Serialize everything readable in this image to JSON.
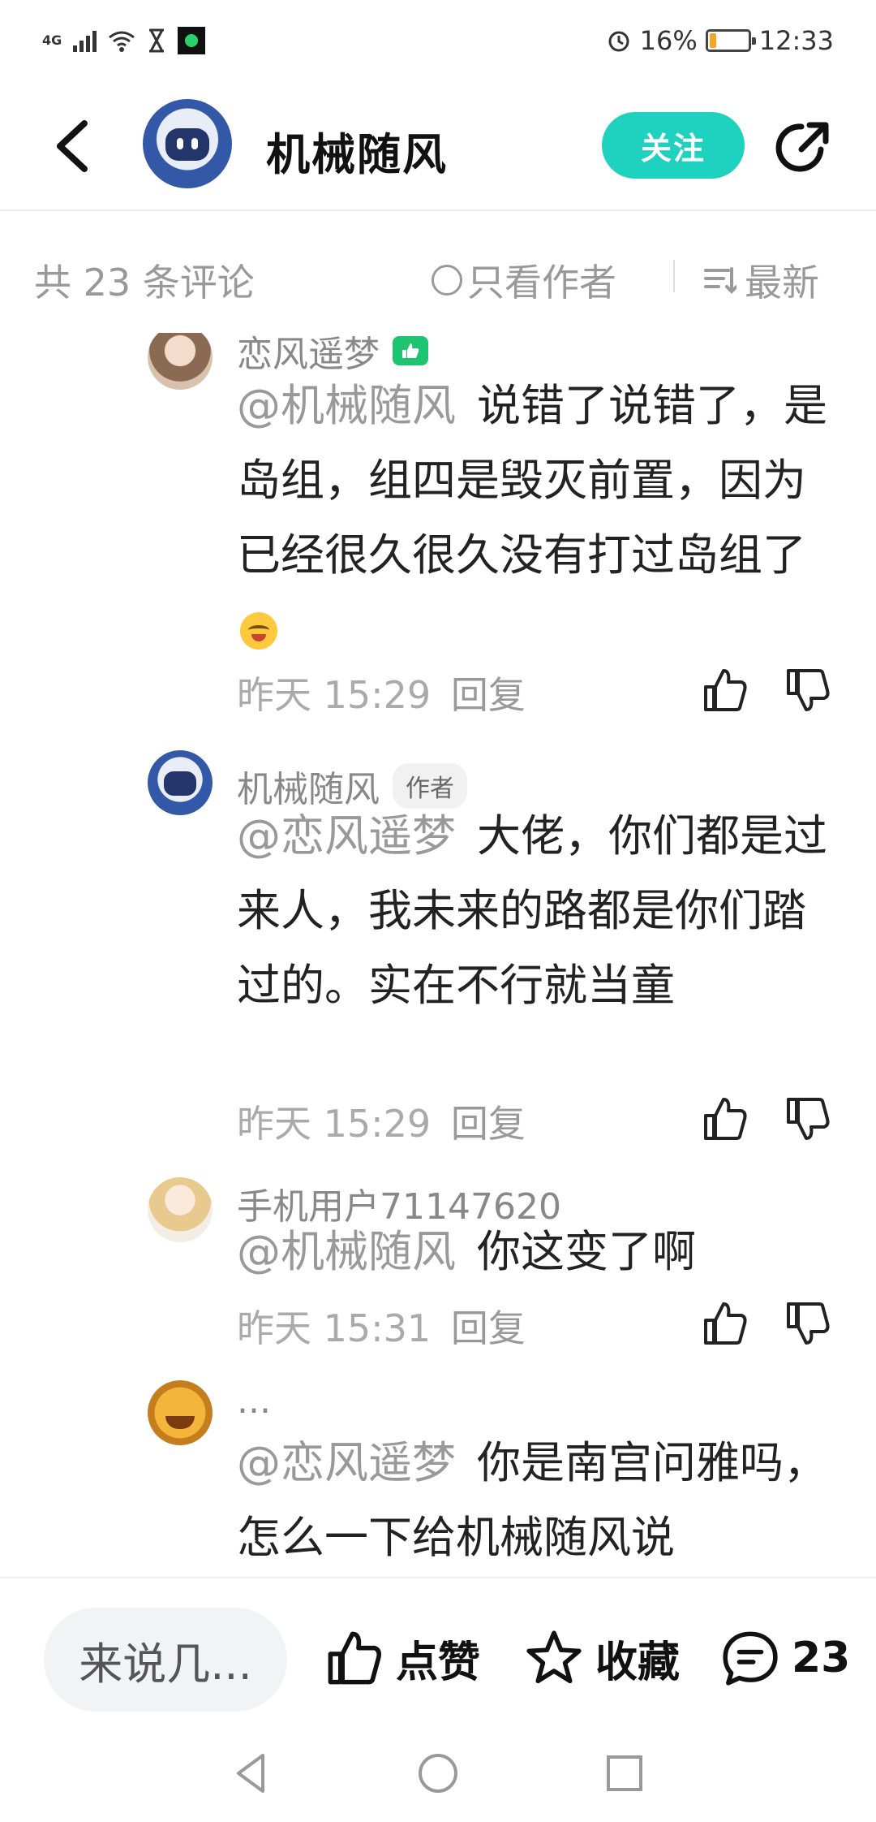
{
  "status_bar": {
    "network": "4G",
    "battery_percent": "16%",
    "time": "12:33",
    "icons": [
      "signal-icon",
      "wifi-icon",
      "hourglass-icon",
      "app-badge-icon",
      "alarm-icon",
      "battery-icon"
    ],
    "battery_level": 0.16
  },
  "header": {
    "title": "机械随风",
    "follow_label": "关注",
    "accent_color": "#1fd1bf"
  },
  "filter_bar": {
    "count_label": "共 23 条评论",
    "author_only_label": "只看作者",
    "sort_label": "最新"
  },
  "comments": [
    {
      "name": "恋风遥梦",
      "mention": "@机械随风",
      "text": "说错了说错了，是岛组，组四是毁灭前置，因为已经很久很久没有打过岛组了",
      "time": "昨天 15:29",
      "reply_label": "回复"
    },
    {
      "name": "机械随风",
      "author_tag": "作者",
      "mention": "@恋风遥梦",
      "text": "大佬，你们都是过来人，我未来的路都是你们踏过的。实在不行就当童",
      "time": "昨天 15:29",
      "reply_label": "回复"
    },
    {
      "name": "手机用户71147620",
      "mention": "@机械随风",
      "text": "你这变了啊",
      "time": "昨天 15:31",
      "reply_label": "回复"
    },
    {
      "name": "...",
      "mention": "@恋风遥梦",
      "text": "你是南宫问雅吗，怎么一下给机械随风说"
    }
  ],
  "bottom_bar": {
    "input_placeholder": "来说几...",
    "like_label": "点赞",
    "favorite_label": "收藏",
    "comment_count": "23"
  }
}
